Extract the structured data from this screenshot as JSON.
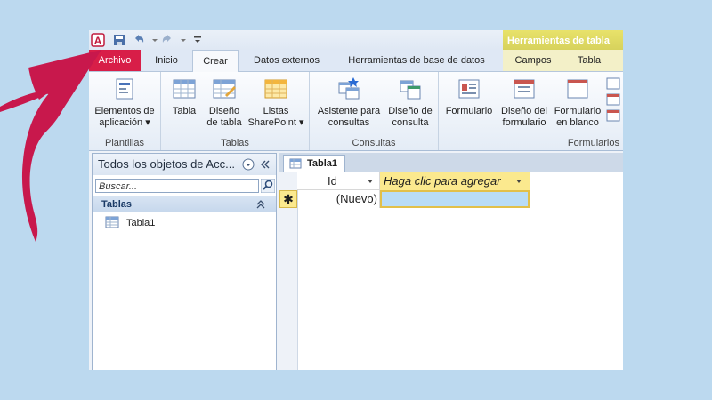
{
  "ribbon_tabs": {
    "file": "Archivo",
    "home": "Inicio",
    "create": "Crear",
    "external": "Datos externos",
    "dbtools": "Herramientas de base de datos"
  },
  "context": {
    "header": "Herramientas de tabla",
    "tabs": [
      "Campos",
      "Tabla"
    ]
  },
  "groups": {
    "templates": {
      "label": "Plantillas",
      "buttons": [
        {
          "label": "Elementos de\naplicación ▾"
        }
      ]
    },
    "tables": {
      "label": "Tablas",
      "buttons": [
        {
          "label": "Tabla"
        },
        {
          "label": "Diseño\nde tabla"
        },
        {
          "label": "Listas\nSharePoint ▾"
        }
      ]
    },
    "queries": {
      "label": "Consultas",
      "buttons": [
        {
          "label": "Asistente para\nconsultas"
        },
        {
          "label": "Diseño de\nconsulta"
        }
      ]
    },
    "forms": {
      "label": "Formularios",
      "buttons": [
        {
          "label": "Formulario"
        },
        {
          "label": "Diseño del\nformulario"
        },
        {
          "label": "Formulario\nen blanco"
        }
      ]
    }
  },
  "nav": {
    "title": "Todos los objetos de Acc...",
    "search_placeholder": "Buscar...",
    "section": "Tablas",
    "item": "Tabla1"
  },
  "doc": {
    "tab": "Tabla1",
    "col_id": "Id",
    "col_add": "Haga clic para agregar",
    "new_row": "(Nuevo)",
    "star": "✱"
  },
  "colors": {
    "file_tab": "#d81e48",
    "arrow": "#c8184c",
    "accent": "#fbe98e"
  }
}
